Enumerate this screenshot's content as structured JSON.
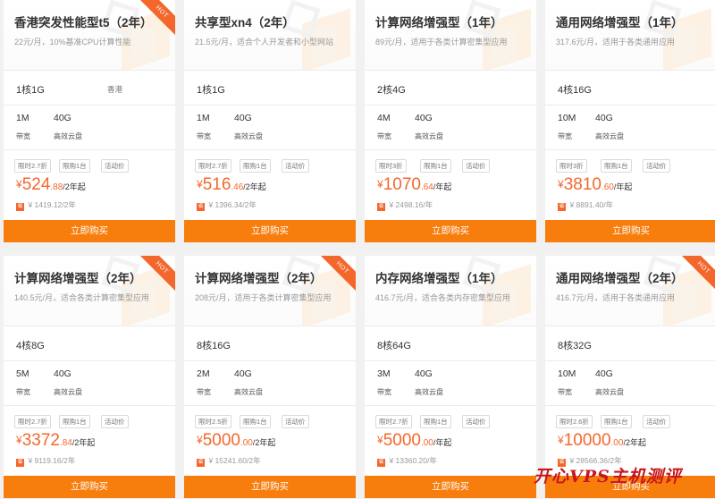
{
  "plans": [
    {
      "title": "香港突发性能型t5（2年）",
      "desc": "22元/月，10%基准CPU计算性能",
      "spec": "1核1G",
      "region": "香港",
      "bw": "1M",
      "disk": "40G",
      "bw_label": "带宽",
      "disk_label": "高效云盘",
      "tags": [
        "限时2.7折",
        "限购1台",
        "活动价"
      ],
      "currency": "¥",
      "price_int": "524",
      "price_dec": ".88",
      "price_unit": "/2年起",
      "orig_badge": "省",
      "orig": "¥ 1419.12/2年",
      "buy": "立即购买",
      "hot": "HOT"
    },
    {
      "title": "共享型xn4（2年）",
      "desc": "21.5元/月，适合个人开发者和小型网站",
      "spec": "1核1G",
      "region": "",
      "bw": "1M",
      "disk": "40G",
      "bw_label": "带宽",
      "disk_label": "高效云盘",
      "tags": [
        "限时2.7折",
        "限购1台",
        "活动价"
      ],
      "currency": "¥",
      "price_int": "516",
      "price_dec": ".46",
      "price_unit": "/2年起",
      "orig_badge": "省",
      "orig": "¥ 1396.34/2年",
      "buy": "立即购买",
      "hot": ""
    },
    {
      "title": "计算网络增强型（1年）",
      "desc": "89元/月，适用于各类计算密集型应用",
      "spec": "2核4G",
      "region": "",
      "bw": "4M",
      "disk": "40G",
      "bw_label": "带宽",
      "disk_label": "高效云盘",
      "tags": [
        "限时3折",
        "限购1台",
        "活动价"
      ],
      "currency": "¥",
      "price_int": "1070",
      "price_dec": ".64",
      "price_unit": "/年起",
      "orig_badge": "省",
      "orig": "¥ 2498.16/年",
      "buy": "立即购买",
      "hot": ""
    },
    {
      "title": "通用网络增强型（1年）",
      "desc": "317.6元/月，适用于各类通用应用",
      "spec": "4核16G",
      "region": "",
      "bw": "10M",
      "disk": "40G",
      "bw_label": "带宽",
      "disk_label": "高效云盘",
      "tags": [
        "限时3折",
        "限购1台",
        "活动价"
      ],
      "currency": "¥",
      "price_int": "3810",
      "price_dec": ".60",
      "price_unit": "/年起",
      "orig_badge": "省",
      "orig": "¥ 8891.40/年",
      "buy": "立即购买",
      "hot": ""
    },
    {
      "title": "计算网络增强型（2年）",
      "desc": "140.5元/月，适合各类计算密集型应用",
      "spec": "4核8G",
      "region": "",
      "bw": "5M",
      "disk": "40G",
      "bw_label": "带宽",
      "disk_label": "高效云盘",
      "tags": [
        "限时2.7折",
        "限购1台",
        "活动价"
      ],
      "currency": "¥",
      "price_int": "3372",
      "price_dec": ".84",
      "price_unit": "/2年起",
      "orig_badge": "省",
      "orig": "¥ 9119.16/2年",
      "buy": "立即购买",
      "hot": "HOT"
    },
    {
      "title": "计算网络增强型（2年）",
      "desc": "208元/月，适用于各类计算密集型应用",
      "spec": "8核16G",
      "region": "",
      "bw": "2M",
      "disk": "40G",
      "bw_label": "带宽",
      "disk_label": "高效云盘",
      "tags": [
        "限时2.5折",
        "限购1台",
        "活动价"
      ],
      "currency": "¥",
      "price_int": "5000",
      "price_dec": ".00",
      "price_unit": "/2年起",
      "orig_badge": "省",
      "orig": "¥ 15241.60/2年",
      "buy": "立即购买",
      "hot": "HOT"
    },
    {
      "title": "内存网络增强型（1年）",
      "desc": "416.7元/月，适合各类内存密集型应用",
      "spec": "8核64G",
      "region": "",
      "bw": "3M",
      "disk": "40G",
      "bw_label": "带宽",
      "disk_label": "高效云盘",
      "tags": [
        "限时2.7折",
        "限购1台",
        "活动价"
      ],
      "currency": "¥",
      "price_int": "5000",
      "price_dec": ".00",
      "price_unit": "/年起",
      "orig_badge": "省",
      "orig": "¥ 13360.20/年",
      "buy": "立即购买",
      "hot": ""
    },
    {
      "title": "通用网络增强型（2年）",
      "desc": "416.7元/月，适用于各类通用应用",
      "spec": "8核32G",
      "region": "",
      "bw": "10M",
      "disk": "40G",
      "bw_label": "带宽",
      "disk_label": "高效云盘",
      "tags": [
        "限时2.6折",
        "限购1台",
        "活动价"
      ],
      "currency": "¥",
      "price_int": "10000",
      "price_dec": ".00",
      "price_unit": "/2年起",
      "orig_badge": "省",
      "orig": "¥ 28566.36/2年",
      "buy": "立即购买",
      "hot": "HOT"
    }
  ],
  "watermark": "开心VPS主机测评",
  "colors": {
    "accent": "#f4672c",
    "button": "#f77d0d",
    "watermark": "#c8161d"
  }
}
